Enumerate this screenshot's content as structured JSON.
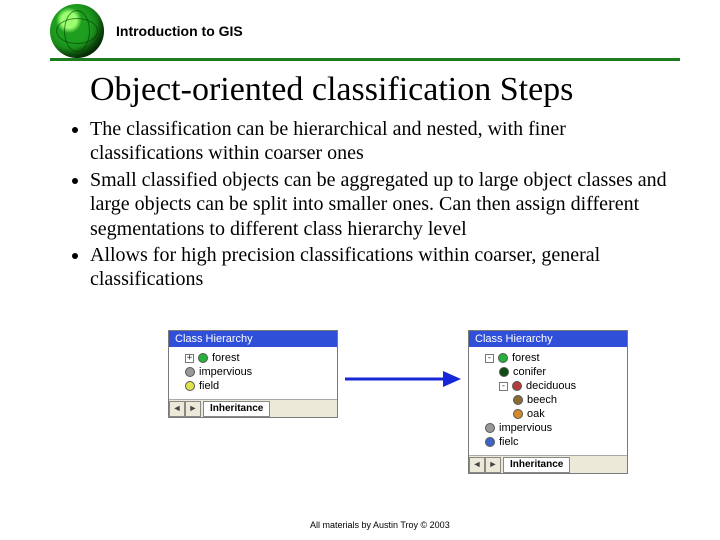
{
  "header": {
    "course": "Introduction to GIS"
  },
  "title": "Object-oriented classification Steps",
  "bullets": [
    "The classification can be hierarchical and nested, with finer classifications within coarser ones",
    "Small classified objects can be aggregated up to large object classes and large objects can be split into smaller ones. Can then assign different segmentations to different class hierarchy level",
    "Allows for high precision classifications within coarser, general classifications"
  ],
  "panel_left": {
    "title": "Class Hierarchy",
    "items": [
      {
        "expander": "+",
        "color": "c-green",
        "label": "forest"
      },
      {
        "expander": "",
        "color": "c-grey",
        "label": "impervious"
      },
      {
        "expander": "",
        "color": "c-yellow",
        "label": "field"
      }
    ],
    "tab": "Inheritance",
    "scroll_left": "◄",
    "scroll_right": "►"
  },
  "panel_right": {
    "title": "Class Hierarchy",
    "items": [
      {
        "indent": 1,
        "expander": "-",
        "color": "c-green",
        "label": "forest"
      },
      {
        "indent": 2,
        "expander": "",
        "color": "c-dgreen",
        "label": "conifer"
      },
      {
        "indent": 2,
        "expander": "-",
        "color": "c-red",
        "label": "deciduous"
      },
      {
        "indent": 3,
        "expander": "",
        "color": "c-brown",
        "label": "beech"
      },
      {
        "indent": 3,
        "expander": "",
        "color": "c-orange",
        "label": "oak"
      },
      {
        "indent": 1,
        "expander": "",
        "color": "c-grey",
        "label": "impervious"
      },
      {
        "indent": 1,
        "expander": "",
        "color": "c-blue",
        "label": "fielc"
      }
    ],
    "tab": "Inheritance",
    "scroll_left": "◄",
    "scroll_right": "►"
  },
  "credit": "All materials by Austin Troy © 2003"
}
